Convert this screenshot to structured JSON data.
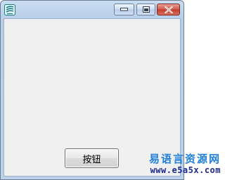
{
  "window": {
    "title": "",
    "icon": "app-logo-icon",
    "controls": {
      "minimize_icon": "minimize-icon",
      "maximize_icon": "maximize-icon",
      "close_icon": "close-icon"
    }
  },
  "main": {
    "button_label": "按钮"
  },
  "watermark": {
    "site_name": "易语言资源网",
    "url": "www.e5a5x.com"
  },
  "colors": {
    "client_bg": "#f0f0f0",
    "close_red": "#c33a2c",
    "watermark_blue": "#1f7fd8",
    "watermark_navy": "#1a2a8c"
  }
}
